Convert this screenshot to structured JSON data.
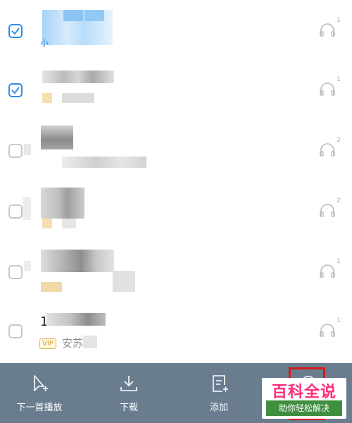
{
  "song_list": {
    "rows": [
      {
        "checked": true,
        "extra_text": "小",
        "headphone_count": "1"
      },
      {
        "checked": true,
        "headphone_count": "1"
      },
      {
        "checked": false,
        "headphone_count": "2"
      },
      {
        "checked": false,
        "headphone_count": "2"
      },
      {
        "checked": false,
        "headphone_count": "1"
      },
      {
        "checked": false,
        "title_fragment": "1",
        "vip_badge": "VIP",
        "singer_fragment": "安苏",
        "headphone_count": "1"
      }
    ]
  },
  "toolbar": {
    "items": [
      {
        "label": "下一首播放",
        "icon": "play-next-icon"
      },
      {
        "label": "下载",
        "icon": "download-icon"
      },
      {
        "label": "添加",
        "icon": "add-to-list-icon"
      }
    ]
  },
  "watermark": {
    "title": "百科全说",
    "subtitle": "助你轻松解决"
  },
  "colors": {
    "toolbar_bg": "#697d8f",
    "checked_blue": "#2f8fe8",
    "highlight_red": "#d21c1c",
    "watermark_pink": "#ff2d7a",
    "watermark_green": "#3f8f3f"
  }
}
